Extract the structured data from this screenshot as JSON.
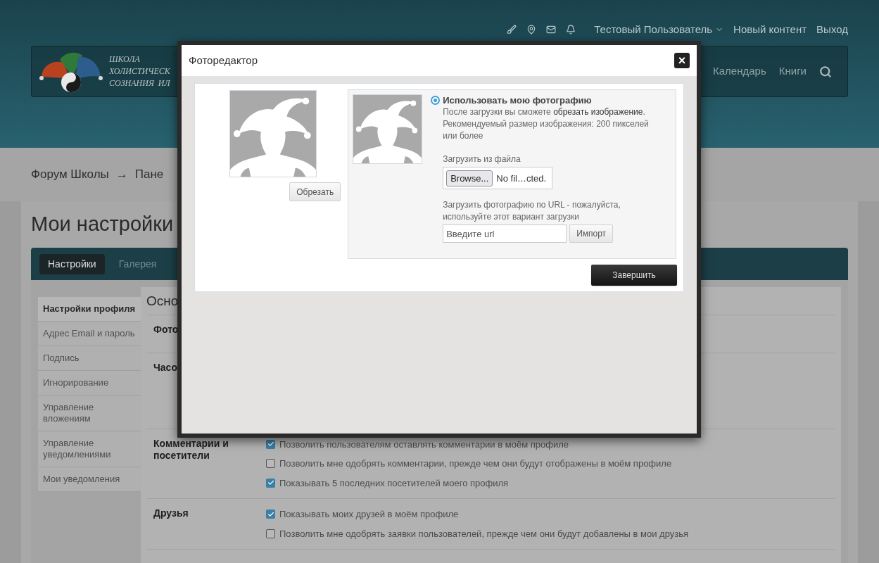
{
  "header": {
    "user_menu": "Тестовый Пользователь",
    "links": [
      "Новый контент",
      "Выход"
    ]
  },
  "logo": {
    "lines": [
      "ШКОЛА",
      "ХОЛИСТИЧЕСК",
      "СОЗНАНИЯ  ИЛ"
    ]
  },
  "nav": {
    "items": [
      "Календарь",
      "Книги"
    ]
  },
  "breadcrumb": {
    "items": [
      "Форум Школы",
      "Пане"
    ],
    "separator": "→"
  },
  "page_title": "Мои настройки",
  "tabs": [
    {
      "label": "Настройки",
      "selected": true
    },
    {
      "label": "Галерея",
      "selected": false
    }
  ],
  "sidebar": {
    "items": [
      {
        "label": "Настройки профиля",
        "selected": true
      },
      {
        "label": "Адрес Email и пароль",
        "selected": false
      },
      {
        "label": "Подпись",
        "selected": false
      },
      {
        "label": "Игнорирование",
        "selected": false
      },
      {
        "label": "Управление вложениям",
        "selected": false
      },
      {
        "label": "Управление уведомлениями",
        "selected": false
      },
      {
        "label": "Мои уведомления",
        "selected": false
      }
    ]
  },
  "section_title": "Осно",
  "groups": [
    {
      "label": "Фото"
    },
    {
      "label": "Часо"
    },
    {
      "label": "Комментарии и посетители",
      "options": [
        {
          "label": "Позволить пользователям оставлять комментарии в моём профиле",
          "checked": true
        },
        {
          "label": "Позволить мне одобрять комментарии, прежде чем они будут отображены в моём профиле",
          "checked": false
        },
        {
          "label": "Показывать 5 последних посетителей моего профиля",
          "checked": true
        }
      ]
    },
    {
      "label": "Друзья",
      "options": [
        {
          "label": "Показывать моих друзей в моём профиле",
          "checked": true
        },
        {
          "label": "Позволить мне одобрять заявки пользователей, прежде чем они будут добавлены в мои друзья",
          "checked": false
        }
      ]
    }
  ],
  "dialog": {
    "title": "Фоторедактор",
    "close": "×",
    "crop_button": "Обрезать",
    "option": {
      "label": "Использовать мою фотографию",
      "selected": true
    },
    "hint": "После загрузки вы сможете **обрезать изображение**.",
    "size_hint": "Рекомендуемый размер изображения: 200 пикселей или более",
    "file_label": "Загрузить из файла",
    "browse_button": "Browse...",
    "file_status": "No fil…cted.",
    "url_label": "Загрузить фотографию по URL - пожалуйста, используйте этот вариант загрузки",
    "url_placeholder": "Введите url",
    "import_button": "Импорт",
    "finish_button": "Завершить"
  }
}
